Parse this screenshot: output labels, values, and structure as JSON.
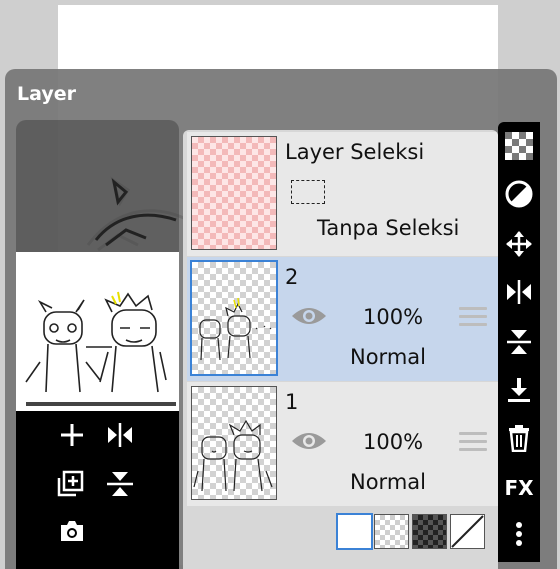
{
  "panel": {
    "title": "Layer"
  },
  "layers": [
    {
      "name": "Layer Seleksi",
      "selection_text": "Tanpa Seleksi"
    },
    {
      "name": "2",
      "opacity": "100%",
      "blend": "Normal",
      "selected": true
    },
    {
      "name": "1",
      "opacity": "100%",
      "blend": "Normal",
      "selected": false
    }
  ],
  "left_tools": [
    "add-layer-icon",
    "flip-horizontal-icon",
    "duplicate-layer-icon",
    "flip-vertical-icon",
    "camera-icon"
  ],
  "right_tools": [
    "transparency-icon",
    "contrast-icon",
    "move-icon",
    "flip-horizontal-icon",
    "flip-vertical-icon",
    "merge-down-icon",
    "trash-icon",
    "fx",
    "more-icon"
  ],
  "right_bar": {
    "fx_label": "FX"
  },
  "swatches": [
    "white",
    "light-checker",
    "dark-checker",
    "none"
  ],
  "colors": {
    "selected_row": "#c6d6ec",
    "selected_border": "#3b82d6",
    "toolbar": "#000000"
  }
}
